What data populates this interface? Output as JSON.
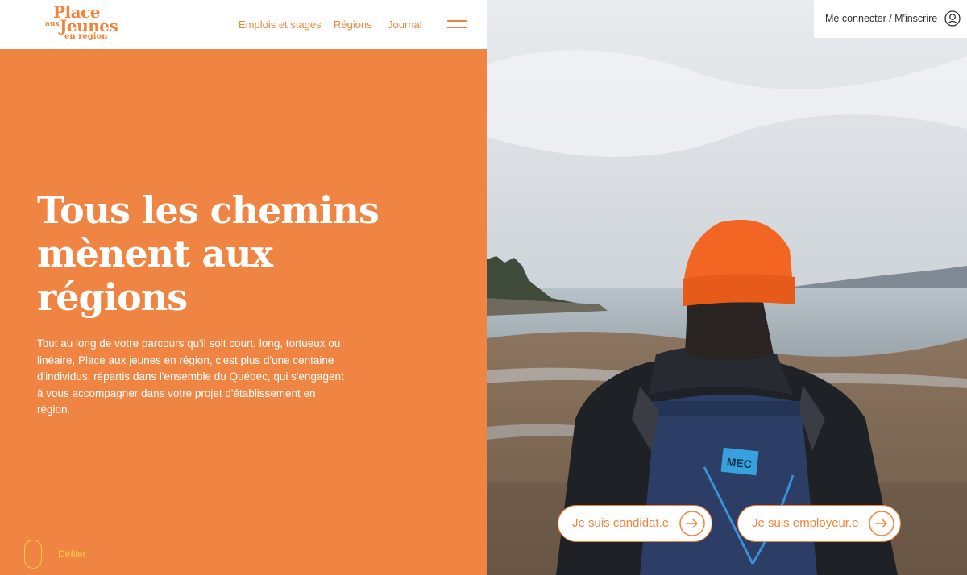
{
  "logo": {
    "line1": "Place",
    "line2": "aux",
    "line3": "Jeunes",
    "line4": "en région"
  },
  "nav": {
    "items": [
      "Emplois et stages",
      "Régions",
      "Journal"
    ]
  },
  "account": {
    "login_label": "Me connecter / M'inscrire"
  },
  "hero": {
    "title": "Tous les chemins mènent aux régions",
    "text": "Tout au long de votre parcours qu'il soit court, long, tortueux ou linéaire, Place aux jeunes en région, c'est plus d'une centaine d'individus, répartis dans l'ensemble du Québec, qui s'engagent à vous accompagner dans votre projet d'établissement en région.",
    "scroll_label": "Défiler"
  },
  "cta": {
    "candidate_label": "Je suis candidat.e",
    "employer_label": "Je suis employeur.e"
  },
  "photo": {
    "bag_brand": "MEC"
  },
  "colors": {
    "brand_orange": "#f08443",
    "white": "#ffffff",
    "scroll_yellow": "#f7d046"
  },
  "icons": [
    "menu-icon",
    "user-icon",
    "arrow-right-icon",
    "scroll-icon"
  ]
}
